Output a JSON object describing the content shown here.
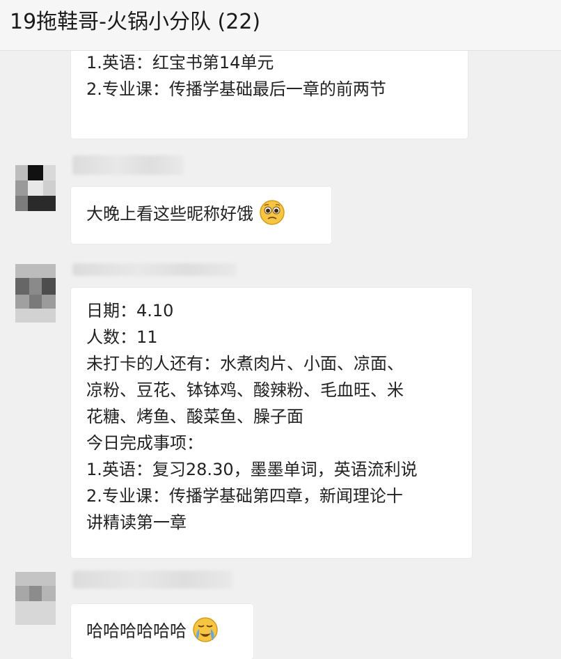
{
  "header": {
    "title": "19拖鞋哥-火锅小分队 (22)"
  },
  "messages": [
    {
      "lines": [
        "1.英语：红宝书第14单元",
        "2.专业课：传播学基础最后一章的前两节"
      ]
    },
    {
      "text": "大晚上看这些昵称好饿",
      "emoji": "pleading-face-emoji"
    },
    {
      "lines": [
        "日期：4.10",
        "人数：11",
        "未打卡的人还有：水煮肉片、小面、凉面、",
        "凉粉、豆花、钵钵鸡、酸辣粉、毛血旺、米",
        "花糖、烤鱼、酸菜鱼、臊子面",
        "今日完成事项：",
        "1.英语：复习28.30，墨墨单词，英语流利说",
        "2.专业课：传播学基础第四章，新闻理论十",
        "讲精读第一章"
      ]
    },
    {
      "text": "哈哈哈哈哈哈",
      "emoji": "loudly-crying-face-emoji"
    }
  ],
  "colors": {
    "background": "#f0f0f0",
    "bubble": "#ffffff",
    "emoji_yellow": "#f6c542",
    "tear_blue": "#5fa8e8"
  }
}
